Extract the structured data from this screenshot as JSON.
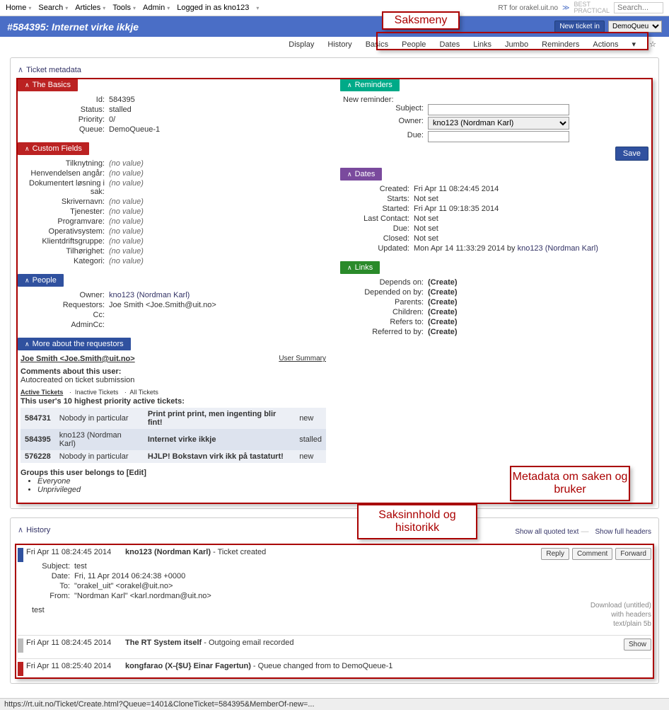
{
  "topmenu": {
    "items": [
      "Home",
      "Search",
      "Articles",
      "Tools",
      "Admin"
    ],
    "logged_in": "Logged in as kno123",
    "right_text": "RT for orakel.uit.no",
    "bp1": "BEST",
    "bp2": "PRACTICAL",
    "search_placeholder": "Search..."
  },
  "header": {
    "title": "#584395: Internet virke ikkje",
    "new_ticket": "New ticket in",
    "queue_sel": "DemoQueu"
  },
  "submenu": [
    "Display",
    "History",
    "Basics",
    "People",
    "Dates",
    "Links",
    "Jumbo",
    "Reminders",
    "Actions"
  ],
  "annot": {
    "saksmeny": "Saksmeny",
    "meta": "Metadata om saken og bruker",
    "innhold": "Saksinnhold og hisitorikk"
  },
  "meta": {
    "title": "Ticket metadata",
    "basics": {
      "title": "The Basics",
      "id_l": "Id:",
      "id_v": "584395",
      "status_l": "Status:",
      "status_v": "stalled",
      "priority_l": "Priority:",
      "priority_v": "0/",
      "queue_l": "Queue:",
      "queue_v": "DemoQueue-1"
    },
    "cf": {
      "title": "Custom Fields",
      "fields": [
        {
          "l": "Tilknytning:",
          "v": "(no value)"
        },
        {
          "l": "Henvendelsen angår:",
          "v": "(no value)"
        },
        {
          "l": "Dokumentert løsning i sak:",
          "v": "(no value)"
        },
        {
          "l": "Skrivernavn:",
          "v": "(no value)"
        },
        {
          "l": "Tjenester:",
          "v": "(no value)"
        },
        {
          "l": "Programvare:",
          "v": "(no value)"
        },
        {
          "l": "Operativsystem:",
          "v": "(no value)"
        },
        {
          "l": "Klientdriftsgruppe:",
          "v": "(no value)"
        },
        {
          "l": "Tilhørighet:",
          "v": "(no value)"
        },
        {
          "l": "Kategori:",
          "v": "(no value)"
        }
      ]
    },
    "people": {
      "title": "People",
      "owner_l": "Owner:",
      "owner_v": "kno123 (Nordman Karl)",
      "req_l": "Requestors:",
      "req_v": "Joe Smith <Joe.Smith@uit.no>",
      "cc_l": "Cc:",
      "cc_v": "",
      "admincc_l": "AdminCc:",
      "admincc_v": ""
    },
    "more": {
      "title": "More about the requestors",
      "user": "Joe Smith <Joe.Smith@uit.no>",
      "summary": "User Summary",
      "comments_l": "Comments about this user:",
      "comments_v": "Autocreated on ticket submission",
      "tabs": [
        "Active Tickets",
        "Inactive Tickets",
        "All Tickets"
      ],
      "intro": "This user's 10 highest priority active tickets:",
      "tickets": [
        {
          "id": "584731",
          "owner": "Nobody in particular",
          "subj": "Print print print, men ingenting blir fint!",
          "status": "new"
        },
        {
          "id": "584395",
          "owner": "kno123 (Nordman Karl)",
          "subj": "Internet virke ikkje",
          "status": "stalled"
        },
        {
          "id": "576228",
          "owner": "Nobody in particular",
          "subj": "HJLP! Bokstavn virk ikk på tastaturt!",
          "status": "new"
        }
      ],
      "groups_l": "Groups this user belongs to",
      "edit": "[Edit]",
      "groups": [
        "Everyone",
        "Unprivileged"
      ]
    },
    "reminders": {
      "title": "Reminders",
      "new": "New reminder:",
      "subject_l": "Subject:",
      "owner_l": "Owner:",
      "owner_v": "kno123 (Nordman Karl)",
      "due_l": "Due:",
      "save": "Save"
    },
    "dates": {
      "title": "Dates",
      "rows": [
        {
          "l": "Created:",
          "v": "Fri Apr 11 08:24:45 2014"
        },
        {
          "l": "Starts:",
          "v": "Not set"
        },
        {
          "l": "Started:",
          "v": "Fri Apr 11 09:18:35 2014"
        },
        {
          "l": "Last Contact:",
          "v": "Not set"
        },
        {
          "l": "Due:",
          "v": "Not set"
        },
        {
          "l": "Closed:",
          "v": "Not set"
        }
      ],
      "updated_l": "Updated:",
      "updated_v": "Mon Apr 14 11:33:29 2014 by ",
      "updated_by": "kno123 (Nordman Karl)"
    },
    "links": {
      "title": "Links",
      "rows": [
        {
          "l": "Depends on:",
          "v": "(Create)"
        },
        {
          "l": "Depended on by:",
          "v": "(Create)"
        },
        {
          "l": "Parents:",
          "v": "(Create)"
        },
        {
          "l": "Children:",
          "v": "(Create)"
        },
        {
          "l": "Refers to:",
          "v": "(Create)"
        },
        {
          "l": "Referred to by:",
          "v": "(Create)"
        }
      ]
    }
  },
  "history": {
    "title": "History",
    "show_quoted": "Show all quoted text",
    "show_headers": "Show full headers",
    "e1": {
      "date": "Fri Apr 11 08:24:45 2014",
      "who": "kno123 (Nordman Karl)",
      "what": " - Ticket created",
      "reply": "Reply",
      "comment": "Comment",
      "forward": "Forward",
      "subject_l": "Subject:",
      "subject_v": "test",
      "dated_l": "Date:",
      "dated_v": "Fri, 11 Apr 2014 06:24:38 +0000",
      "to_l": "To:",
      "to_v": "\"orakel_uit\" <orakel@uit.no>",
      "from_l": "From:",
      "from_v": "\"Nordman Karl\" <karl.nordman@uit.no>",
      "body": "test",
      "dl1": "Download (untitled)",
      "dl2": "with headers",
      "dl3": "text/plain 5b"
    },
    "e2": {
      "date": "Fri Apr 11 08:24:45 2014",
      "who": "The RT System itself",
      "what": " - Outgoing email recorded",
      "show": "Show"
    },
    "e3": {
      "date": "Fri Apr 11 08:25:40 2014",
      "who": "kongfarao (X-{$U} Einar Fagertun)",
      "what": " - Queue changed from to DemoQueue-1"
    }
  },
  "statusbar": "https://rt.uit.no/Ticket/Create.html?Queue=1401&CloneTicket=584395&MemberOf-new=..."
}
